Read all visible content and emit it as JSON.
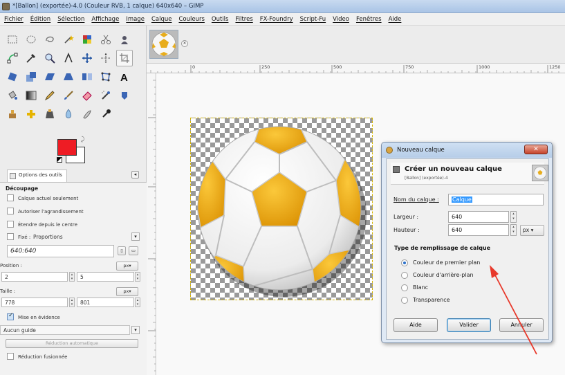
{
  "window": {
    "title": "*[Ballon] (exportée)-4.0 (Couleur RVB, 1 calque) 640x640 – GIMP"
  },
  "menu": [
    "Fichier",
    "Édition",
    "Sélection",
    "Affichage",
    "Image",
    "Calque",
    "Couleurs",
    "Outils",
    "Filtres",
    "FX-Foundry",
    "Script-Fu",
    "Video",
    "Fenêtres",
    "Aide"
  ],
  "tools": [
    "rect-select-icon",
    "ellipse-select-icon",
    "lasso-icon",
    "fuzzy-select-icon",
    "color-select-icon",
    "scissors-icon",
    "foreground-select-icon",
    "paths-icon",
    "color-picker-icon",
    "zoom-icon",
    "measure-icon",
    "move-icon",
    "align-icon",
    "crop-icon",
    "rotate-icon",
    "scale-icon",
    "shear-icon",
    "perspective-icon",
    "flip-icon",
    "cage-icon",
    "text-icon",
    "bucket-fill-icon",
    "blend-icon",
    "pencil-icon",
    "paintbrush-icon",
    "eraser-icon",
    "airbrush-icon",
    "ink-icon",
    "clone-icon",
    "heal-icon",
    "perspective-clone-icon",
    "blur-icon",
    "smudge-icon",
    "dodge-burn-icon"
  ],
  "colors": {
    "foreground": "#ee1c24",
    "background": "#ffffff"
  },
  "tool_options": {
    "tab_label": "Options des outils",
    "section": "Découpage",
    "current_layer_only": "Calque actuel seulement",
    "allow_growing": "Autoriser l'agrandissement",
    "expand_from_center": "Étendre depuis le centre",
    "fixed_label": "Fixé :",
    "fixed_value": "Proportions",
    "ratio": "640:640",
    "position_label": "Position :",
    "position_unit": "px",
    "position_x": "2",
    "position_y": "5",
    "size_label": "Taille :",
    "size_unit": "px",
    "size_w": "778",
    "size_h": "801",
    "highlight": "Mise en évidence",
    "guides": "Aucun guide",
    "auto_shrink": "Réduction automatique",
    "shrink_merged": "Réduction fusionnée"
  },
  "ruler_labels": [
    "0",
    "250",
    "500",
    "750",
    "1000",
    "1250"
  ],
  "dialog": {
    "title": "Nouveau calque",
    "header": "Créer un nouveau calque",
    "subheader": "[Ballon] (exportée)-4",
    "name_label": "Nom du calque :",
    "name_value": "Calque",
    "width_label": "Largeur :",
    "width_value": "640",
    "height_label": "Hauteur :",
    "height_value": "640",
    "unit": "px",
    "fill_section": "Type de remplissage de calque",
    "fill_options": [
      "Couleur de premier plan",
      "Couleur d'arrière-plan",
      "Blanc",
      "Transparence"
    ],
    "fill_selected": "Couleur de premier plan",
    "buttons": {
      "help": "Aide",
      "ok": "Valider",
      "cancel": "Annuler"
    }
  },
  "annotation": {
    "color": "#e8392b"
  }
}
